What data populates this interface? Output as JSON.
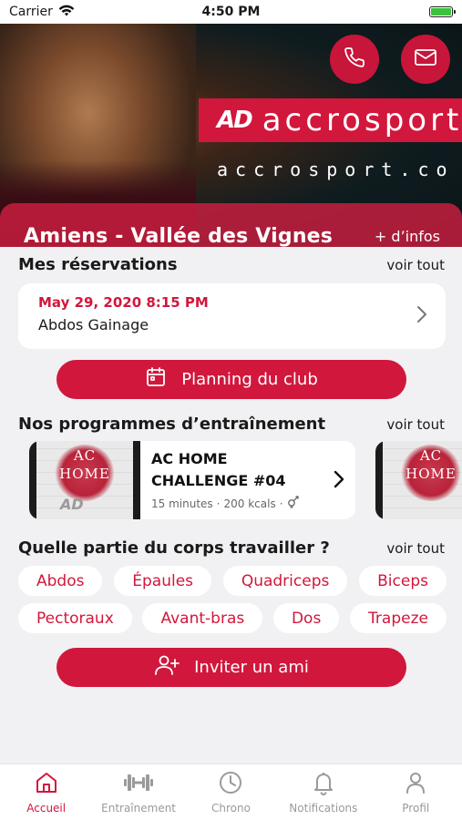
{
  "status_bar": {
    "carrier": "Carrier",
    "time": "4:50 PM"
  },
  "hero": {
    "brand_mark": "AD",
    "brand_name": "accrosport",
    "brand_url": "accrosport.co",
    "club_name": "Amiens - Vallée des Vignes",
    "more_info": "+ d’infos"
  },
  "reservations": {
    "title": "Mes réservations",
    "see_all": "voir tout",
    "items": [
      {
        "date": "May 29, 2020 8:15 PM",
        "name": "Abdos Gainage"
      }
    ]
  },
  "planning_button": "Planning du club",
  "programs": {
    "title": "Nos programmes d’entraînement",
    "see_all": "voir tout",
    "items": [
      {
        "thumb_line1": "AC",
        "thumb_line2": "HOME",
        "thumb_logo": "AD",
        "title": "AC HOME CHALLENGE #04",
        "duration": "15 minutes",
        "calories": "200 kcals"
      },
      {
        "thumb_line1": "AC",
        "thumb_line2": "HOME"
      }
    ]
  },
  "body_parts": {
    "title": "Quelle partie du corps travailler ?",
    "see_all": "voir tout",
    "row1": [
      "Abdos",
      "Épaules",
      "Quadriceps",
      "Biceps"
    ],
    "row2": [
      "Pectoraux",
      "Avant-bras",
      "Dos",
      "Trapeze"
    ]
  },
  "invite_button": "Inviter un ami",
  "tabs": [
    {
      "label": "Accueil",
      "icon": "home-icon",
      "active": true
    },
    {
      "label": "Entraînement",
      "icon": "dumbbell-icon",
      "active": false
    },
    {
      "label": "Chrono",
      "icon": "clock-icon",
      "active": false
    },
    {
      "label": "Notifications",
      "icon": "bell-icon",
      "active": false
    },
    {
      "label": "Profil",
      "icon": "user-icon",
      "active": false
    }
  ],
  "colors": {
    "accent": "#d2173c",
    "background": "#f1f1f3",
    "battery": "#3cc13b"
  }
}
